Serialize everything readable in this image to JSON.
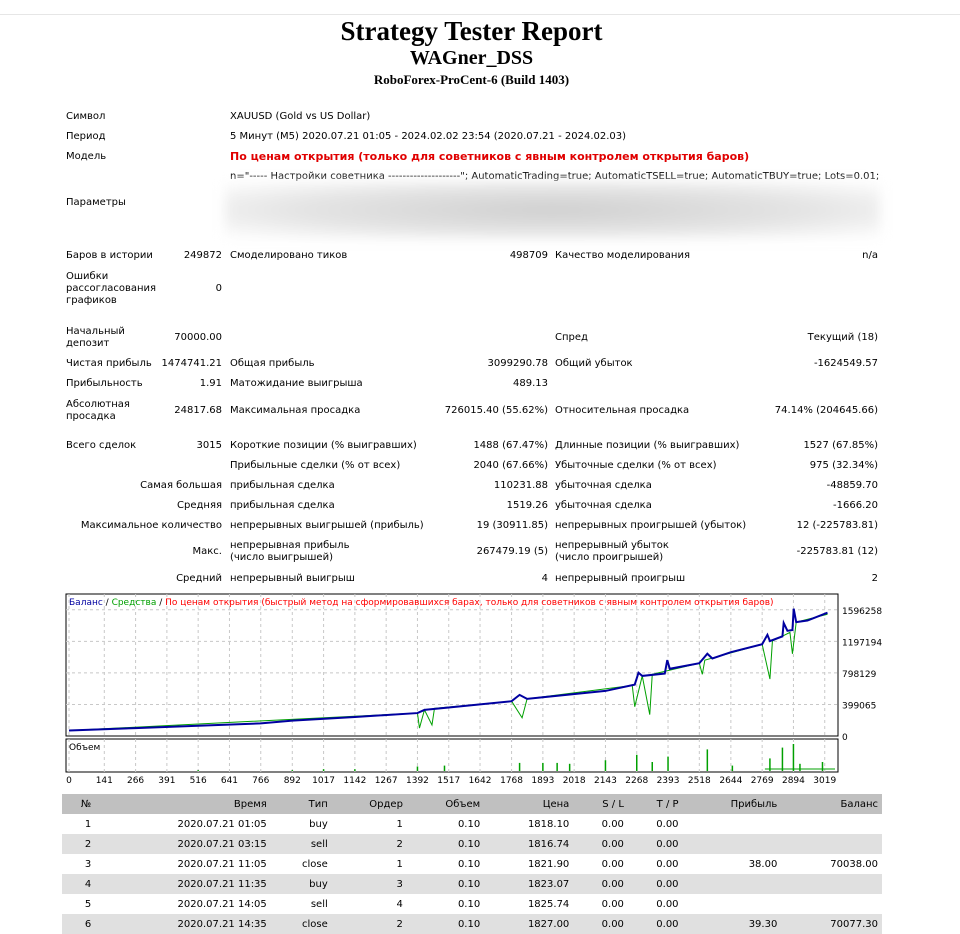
{
  "header": {
    "title": "Strategy Tester Report",
    "expert": "WAGner_DSS",
    "server": "RoboForex-ProCent-6 (Build 1403)"
  },
  "info": {
    "symbol_label": "Символ",
    "symbol": "XAUUSD (Gold vs US Dollar)",
    "period_label": "Период",
    "period": "5 Минут (M5) 2020.07.21 01:05 - 2024.02.02 23:54 (2020.07.21 - 2024.02.03)",
    "model_label": "Модель",
    "model": "По ценам открытия (только для советников с явным контролем открытия баров)",
    "params_label": "Параметры",
    "params": "n=\"----- Настройки советника --------------------\"; AutomaticTrading=true; AutomaticTSELL=true; AutomaticTBUY=true; Lots=0.01;"
  },
  "stats": {
    "bars_label": "Баров в истории",
    "bars": "249872",
    "ticks_label": "Смоделировано тиков",
    "ticks": "498709",
    "quality_label": "Качество моделирования",
    "quality": "n/a",
    "errors_label": "Ошибки рассогласования графиков",
    "errors": "0",
    "deposit_label": "Начальный депозит",
    "deposit": "70000.00",
    "spread_label": "Спред",
    "spread": "Текущий (18)",
    "net_label": "Чистая прибыль",
    "net": "1474741.21",
    "gross_profit_label": "Общая прибыль",
    "gross_profit": "3099290.78",
    "gross_loss_label": "Общий убыток",
    "gross_loss": "-1624549.57",
    "pf_label": "Прибыльность",
    "pf": "1.91",
    "expected_label": "Матожидание выигрыша",
    "expected": "489.13",
    "abs_dd_label": "Абсолютная просадка",
    "abs_dd": "24817.68",
    "max_dd_label": "Максимальная просадка",
    "max_dd": "726015.40 (55.62%)",
    "rel_dd_label": "Относительная просадка",
    "rel_dd": "74.14% (204645.66)",
    "total_label": "Всего сделок",
    "total": "3015",
    "short_label": "Короткие позиции (% выигравших)",
    "short": "1488 (67.47%)",
    "long_label": "Длинные позиции (% выигравших)",
    "long": "1527 (67.85%)",
    "win_label": "Прибыльные сделки (% от всех)",
    "win": "2040 (67.66%)",
    "loss_label": "Убыточные сделки (% от всех)",
    "loss": "975 (32.34%)",
    "largest_label": "Самая большая",
    "largest_win_label": "прибыльная сделка",
    "largest_win": "110231.88",
    "largest_loss_label": "убыточная сделка",
    "largest_loss": "-48859.70",
    "avg_label": "Средняя",
    "avg_win_label": "прибыльная сделка",
    "avg_win": "1519.26",
    "avg_loss_label": "убыточная сделка",
    "avg_loss": "-1666.20",
    "maxcount_label": "Максимальное количество",
    "maxcw_label": "непрерывных выигрышей (прибыль)",
    "maxcw": "19 (30911.85)",
    "maxcl_label": "непрерывных проигрышей (убыток)",
    "maxcl": "12 (-225783.81)",
    "maxs_label": "Макс.",
    "maxcp_label": "непрерывная прибыль (число выигрышей)",
    "maxcp": "267479.19 (5)",
    "maxcloss_label": "непрерывный убыток (число проигрышей)",
    "maxcloss": "-225783.81 (12)",
    "avgc_label": "Средний",
    "avgcw_label": "непрерывный выигрыш",
    "avgcw": "4",
    "avgcl_label": "непрерывный проигрыш",
    "avgcl": "2"
  },
  "chart_data": {
    "type": "line",
    "legend": {
      "balance": "Баланс",
      "sep1": " / ",
      "equity": "Средства",
      "sep2": " / ",
      "model": "По ценам открытия (быстрый метод на сформировавшихся барах, только для советников с явным контролем открытия баров)"
    },
    "volume_label": "Объем",
    "colors": {
      "balance": "#0000a0",
      "equity": "#00a000",
      "volume": "#00a000",
      "model": "#ff0000"
    },
    "ylim": [
      0,
      1795790
    ],
    "xlim": [
      0,
      3060
    ],
    "yticks": [
      0,
      399065,
      798129,
      1197194,
      1596258
    ],
    "xticks": [
      0,
      141,
      266,
      391,
      516,
      641,
      766,
      892,
      1017,
      1142,
      1267,
      1392,
      1517,
      1642,
      1768,
      1893,
      2018,
      2143,
      2268,
      2393,
      2518,
      2644,
      2769,
      2894,
      3019
    ],
    "balance": [
      [
        0,
        70000
      ],
      [
        266,
        100000
      ],
      [
        516,
        130000
      ],
      [
        766,
        160000
      ],
      [
        892,
        195000
      ],
      [
        1142,
        240000
      ],
      [
        1392,
        290000
      ],
      [
        1420,
        330000
      ],
      [
        1517,
        360000
      ],
      [
        1768,
        440000
      ],
      [
        1800,
        520000
      ],
      [
        1830,
        470000
      ],
      [
        1893,
        490000
      ],
      [
        2143,
        570000
      ],
      [
        2260,
        650000
      ],
      [
        2275,
        800000
      ],
      [
        2290,
        760000
      ],
      [
        2380,
        790000
      ],
      [
        2390,
        960000
      ],
      [
        2400,
        850000
      ],
      [
        2518,
        920000
      ],
      [
        2550,
        1040000
      ],
      [
        2570,
        980000
      ],
      [
        2644,
        1060000
      ],
      [
        2769,
        1160000
      ],
      [
        2790,
        1280000
      ],
      [
        2800,
        1200000
      ],
      [
        2850,
        1260000
      ],
      [
        2855,
        1430000
      ],
      [
        2870,
        1330000
      ],
      [
        2890,
        1340000
      ],
      [
        2895,
        1610000
      ],
      [
        2905,
        1440000
      ],
      [
        2950,
        1460000
      ],
      [
        3030,
        1560000
      ]
    ],
    "equity": [
      [
        0,
        70000
      ],
      [
        1392,
        290000
      ],
      [
        1400,
        100000
      ],
      [
        1420,
        330000
      ],
      [
        1450,
        140000
      ],
      [
        1460,
        350000
      ],
      [
        1768,
        440000
      ],
      [
        1810,
        230000
      ],
      [
        1830,
        470000
      ],
      [
        2250,
        640000
      ],
      [
        2260,
        370000
      ],
      [
        2290,
        760000
      ],
      [
        2320,
        270000
      ],
      [
        2330,
        780000
      ],
      [
        2518,
        920000
      ],
      [
        2530,
        780000
      ],
      [
        2540,
        960000
      ],
      [
        2769,
        1160000
      ],
      [
        2800,
        720000
      ],
      [
        2810,
        1200000
      ],
      [
        2880,
        1310000
      ],
      [
        2890,
        1040000
      ],
      [
        2905,
        1440000
      ],
      [
        3030,
        1540000
      ]
    ],
    "volume": [
      [
        516,
        1
      ],
      [
        892,
        1
      ],
      [
        1017,
        2
      ],
      [
        1142,
        2
      ],
      [
        1392,
        5
      ],
      [
        1500,
        6
      ],
      [
        1800,
        9
      ],
      [
        1893,
        9
      ],
      [
        1950,
        9
      ],
      [
        2000,
        8
      ],
      [
        2143,
        12
      ],
      [
        2268,
        18
      ],
      [
        2330,
        10
      ],
      [
        2393,
        16
      ],
      [
        2550,
        24
      ],
      [
        2650,
        6
      ],
      [
        2800,
        14
      ],
      [
        2850,
        26
      ],
      [
        2894,
        30
      ],
      [
        2920,
        8
      ],
      [
        3010,
        10
      ]
    ]
  },
  "table": {
    "headers": [
      "№",
      "Время",
      "Тип",
      "Ордер",
      "Объем",
      "Цена",
      "S / L",
      "T / P",
      "Прибыль",
      "Баланс"
    ],
    "rows": [
      [
        "1",
        "2020.07.21 01:05",
        "buy",
        "1",
        "0.10",
        "1818.10",
        "0.00",
        "0.00",
        "",
        ""
      ],
      [
        "2",
        "2020.07.21 03:15",
        "sell",
        "2",
        "0.10",
        "1816.74",
        "0.00",
        "0.00",
        "",
        ""
      ],
      [
        "3",
        "2020.07.21 11:05",
        "close",
        "1",
        "0.10",
        "1821.90",
        "0.00",
        "0.00",
        "38.00",
        "70038.00"
      ],
      [
        "4",
        "2020.07.21 11:35",
        "buy",
        "3",
        "0.10",
        "1823.07",
        "0.00",
        "0.00",
        "",
        ""
      ],
      [
        "5",
        "2020.07.21 14:05",
        "sell",
        "4",
        "0.10",
        "1825.74",
        "0.00",
        "0.00",
        "",
        ""
      ],
      [
        "6",
        "2020.07.21 14:35",
        "close",
        "2",
        "0.10",
        "1827.00",
        "0.00",
        "0.00",
        "39.30",
        "70077.30"
      ]
    ]
  }
}
